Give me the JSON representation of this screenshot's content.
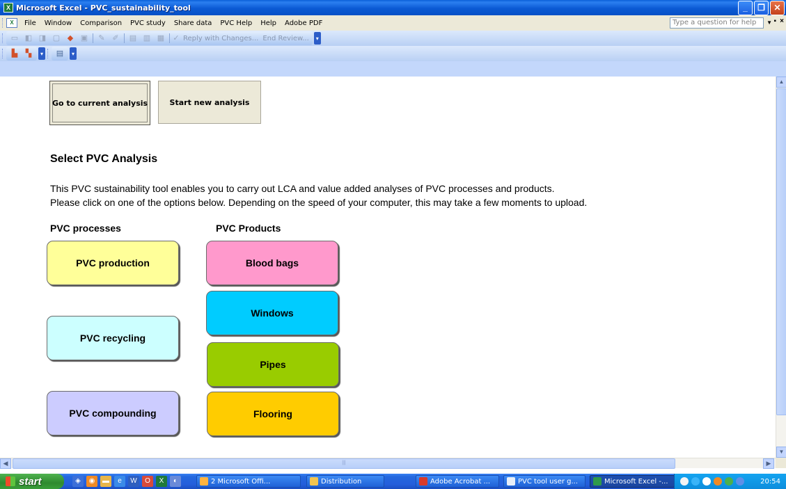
{
  "window": {
    "title": "Microsoft Excel - PVC_sustainability_tool",
    "app_icon": "excel-icon"
  },
  "menu": {
    "items": [
      "File",
      "Window",
      "Comparison",
      "PVC study",
      "Share data",
      "PVC Help",
      "Help",
      "Adobe PDF"
    ],
    "help_placeholder": "Type a question for help"
  },
  "toolbar": {
    "reply_text": "Reply with Changes...",
    "end_review_text": "End Review..."
  },
  "sheet": {
    "buttons": {
      "current": "Go to current analysis",
      "new": "Start new analysis"
    },
    "heading": "Select PVC Analysis",
    "intro_line1": "This PVC sustainability tool enables you to carry out LCA and value added analyses of PVC processes and products.",
    "intro_line2": "Please click on one of the options below. Depending on the speed of your computer, this may take a few moments to upload.",
    "processes": {
      "heading": "PVC processes",
      "items": [
        {
          "label": "PVC production",
          "color": "#ffff99"
        },
        {
          "label": "PVC recycling",
          "color": "#ccffff"
        },
        {
          "label": "PVC compounding",
          "color": "#ccccff"
        }
      ]
    },
    "products": {
      "heading": "PVC Products",
      "items": [
        {
          "label": "Blood bags",
          "color": "#ff99cc"
        },
        {
          "label": "Windows",
          "color": "#00ccff"
        },
        {
          "label": "Pipes",
          "color": "#99cc00"
        },
        {
          "label": "Flooring",
          "color": "#ffcc00"
        }
      ]
    }
  },
  "taskbar": {
    "start": "start",
    "tasks": [
      {
        "label": "2 Microsoft Offi...",
        "active": false
      },
      {
        "label": "Distribution",
        "active": false
      },
      {
        "label": "Adobe Acrobat ...",
        "active": false
      },
      {
        "label": "PVC tool user g...",
        "active": false
      },
      {
        "label": "Microsoft Excel -...",
        "active": true
      }
    ],
    "clock": "20:54"
  }
}
